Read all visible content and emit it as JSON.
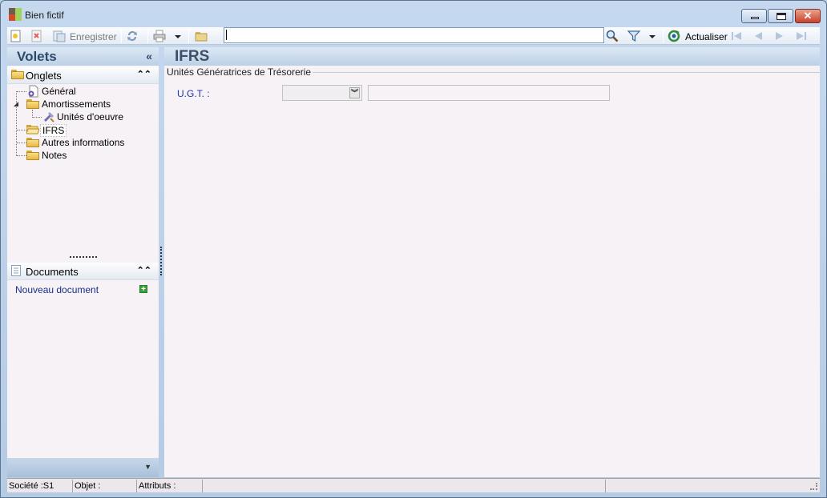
{
  "window": {
    "title": "Bien fictif",
    "controls": {
      "minimize": "minimize",
      "maximize": "maximize",
      "close": "✕"
    }
  },
  "toolbar": {
    "save_label": "Enregistrer",
    "refresh_label": "Actualiser",
    "search_value": ""
  },
  "left_pane": {
    "title": "Volets",
    "collapse_glyph": "«",
    "tabs_section": {
      "title": "Onglets",
      "items": [
        {
          "label": "Général",
          "icon": "general-page-icon"
        },
        {
          "label": "Amortissements",
          "icon": "folder-icon",
          "expanded": true
        },
        {
          "label": "Unités d'oeuvre",
          "icon": "tools-icon"
        },
        {
          "label": "IFRS",
          "icon": "folder-open-icon",
          "selected": true
        },
        {
          "label": "Autres informations",
          "icon": "folder-icon"
        },
        {
          "label": "Notes",
          "icon": "folder-icon"
        }
      ]
    },
    "documents_section": {
      "title": "Documents",
      "new_document_label": "Nouveau document"
    }
  },
  "main": {
    "title": "IFRS",
    "group_title": "Unités Génératrices de Trésorerie",
    "ugt_label": "U.G.T. :",
    "ugt_value": "",
    "ugt_description": ""
  },
  "status_bar": {
    "societe": "Société :S1",
    "objet": "Objet :",
    "attributs": "Attributs :"
  },
  "colors": {
    "panel_bg": "#f6f2f6",
    "header_gradient_top": "#dde8f4",
    "header_gradient_bottom": "#bcd0e6",
    "link": "#1a2d8a",
    "field_label": "#2233aa"
  }
}
